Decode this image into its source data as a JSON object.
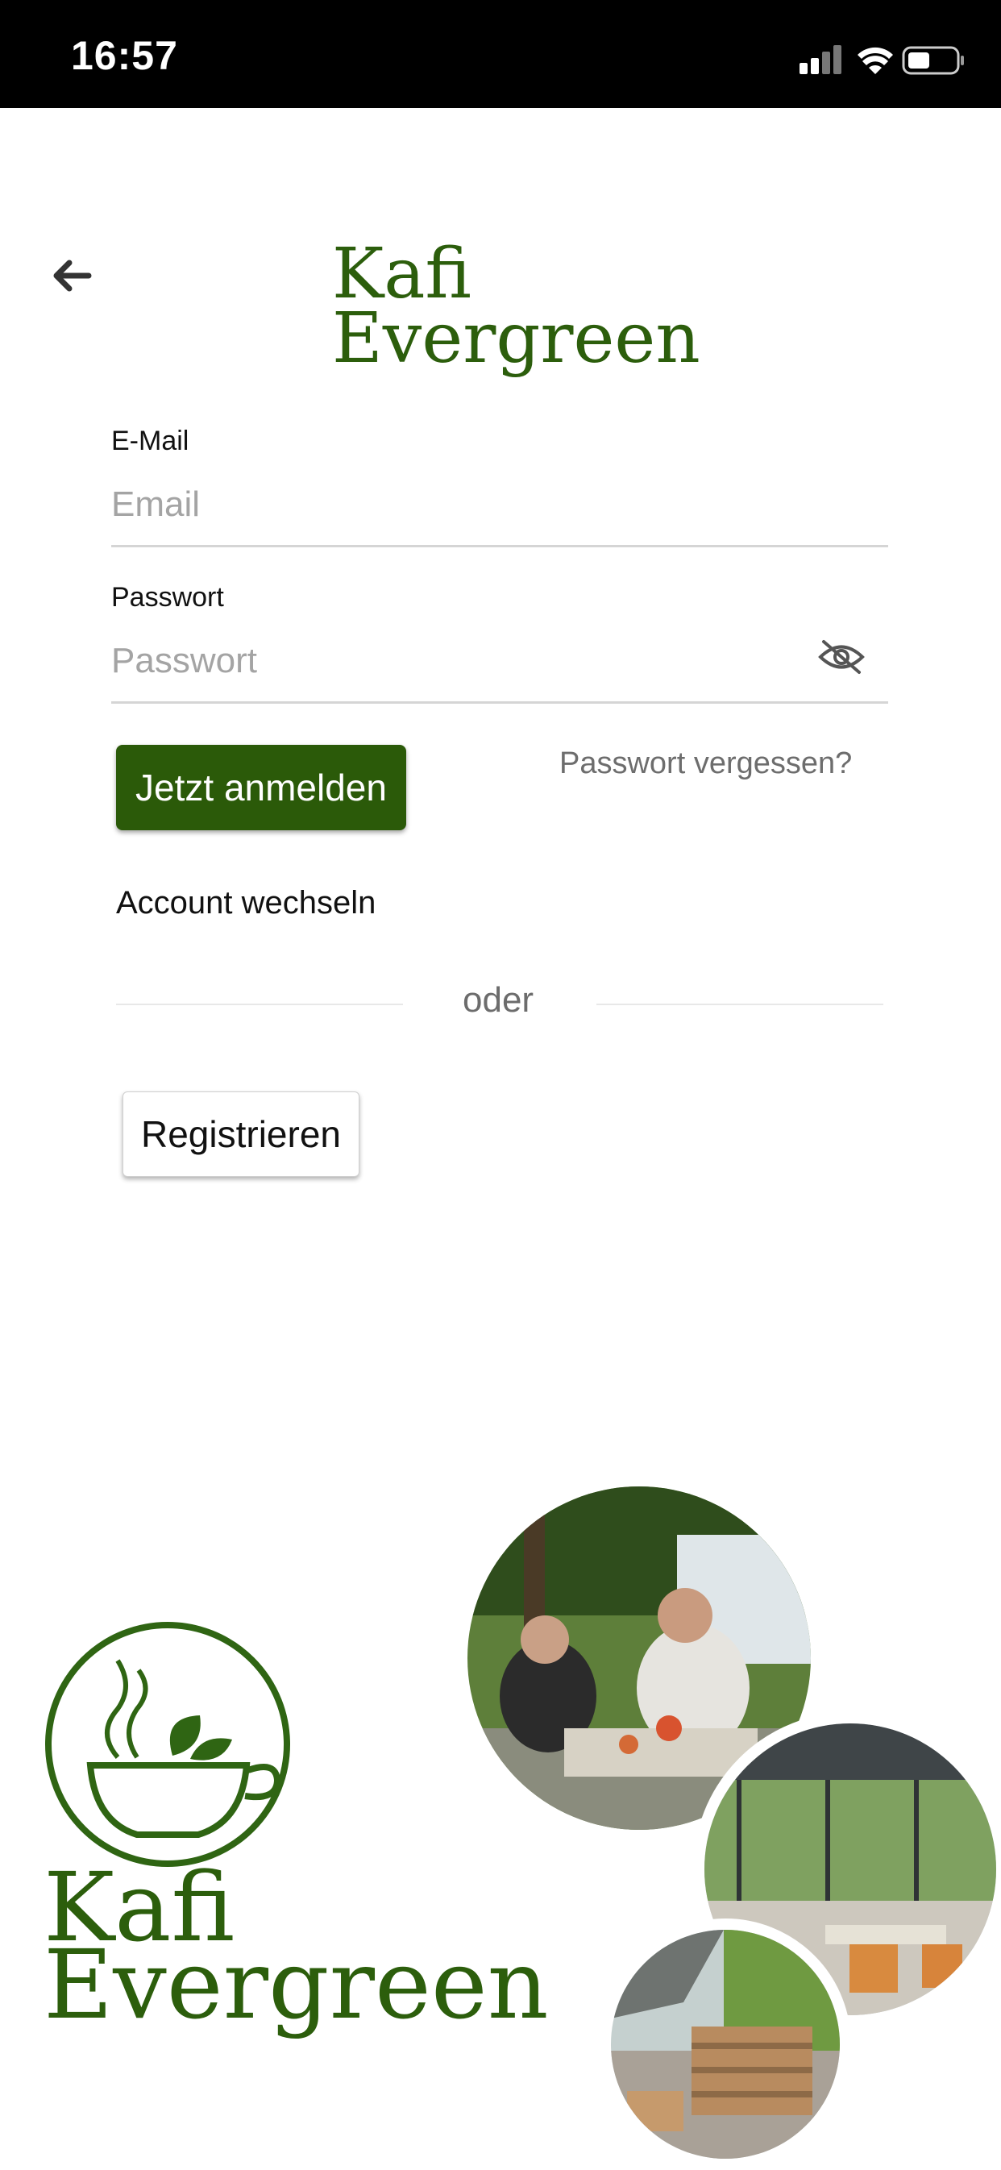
{
  "status_bar": {
    "time": "16:57"
  },
  "header": {
    "title_line1": "Kafi",
    "title_line2": "Evergreen"
  },
  "form": {
    "email_label": "E-Mail",
    "email_placeholder": "Email",
    "password_label": "Passwort",
    "password_placeholder": "Passwort",
    "login_button": "Jetzt anmelden",
    "forgot_link": "Passwort vergessen?",
    "switch_account": "Account wechseln",
    "divider_text": "oder",
    "register_button": "Registrieren"
  },
  "branding": {
    "logo_line1": "Kafi",
    "logo_line2": "Evergreen"
  },
  "colors": {
    "brand_green": "#2b5a09",
    "muted_text": "#6d6d6d"
  },
  "icons": [
    "back-arrow-icon",
    "eye-slash-icon",
    "signal-icon",
    "wifi-icon",
    "battery-icon",
    "coffee-cup-logo"
  ]
}
